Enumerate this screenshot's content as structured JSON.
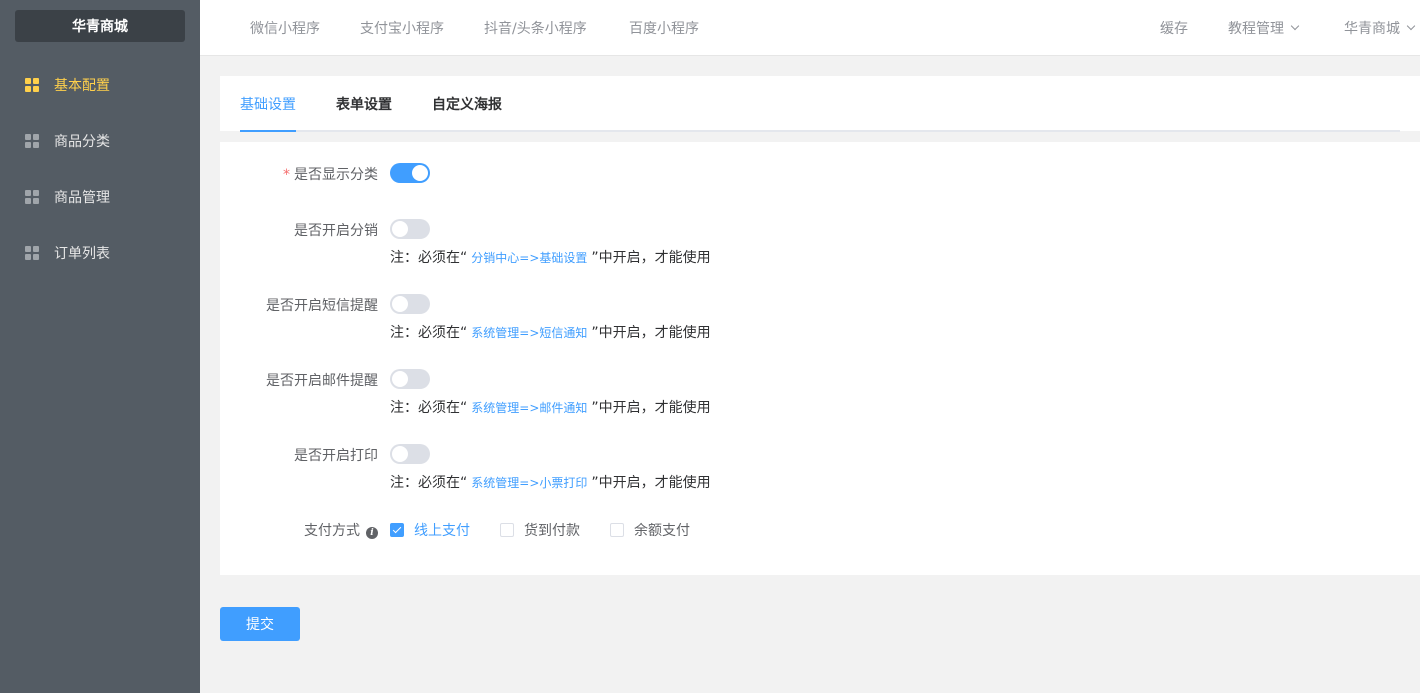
{
  "sidebar": {
    "logo": "华青商城",
    "items": [
      {
        "label": "基本配置",
        "active": true
      },
      {
        "label": "商品分类",
        "active": false
      },
      {
        "label": "商品管理",
        "active": false
      },
      {
        "label": "订单列表",
        "active": false
      }
    ]
  },
  "topnav": {
    "left": [
      "微信小程序",
      "支付宝小程序",
      "抖音/头条小程序",
      "百度小程序"
    ],
    "cache": "缓存",
    "tutorial": "教程管理",
    "shop": "华青商城"
  },
  "tabs": [
    {
      "label": "基础设置",
      "active": true
    },
    {
      "label": "表单设置",
      "active": false
    },
    {
      "label": "自定义海报",
      "active": false
    }
  ],
  "form": {
    "show_category": {
      "required_mark": "*",
      "label": "是否显示分类",
      "enabled": true
    },
    "rows": [
      {
        "label": "是否开启分销",
        "enabled": false,
        "note_prefix": "注：必须在“",
        "note_link": "分销中心=>基础设置",
        "note_suffix": "”中开启，才能使用"
      },
      {
        "label": "是否开启短信提醒",
        "enabled": false,
        "note_prefix": "注：必须在“",
        "note_link": "系统管理=>短信通知",
        "note_suffix": "”中开启，才能使用"
      },
      {
        "label": "是否开启邮件提醒",
        "enabled": false,
        "note_prefix": "注：必须在“",
        "note_link": "系统管理=>邮件通知",
        "note_suffix": "”中开启，才能使用"
      },
      {
        "label": "是否开启打印",
        "enabled": false,
        "note_prefix": "注：必须在“",
        "note_link": "系统管理=>小票打印",
        "note_suffix": "”中开启，才能使用"
      }
    ],
    "payment": {
      "label": "支付方式",
      "info_icon": "info-icon",
      "options": [
        {
          "label": "线上支付",
          "checked": true
        },
        {
          "label": "货到付款",
          "checked": false
        },
        {
          "label": "余额支付",
          "checked": false
        }
      ]
    }
  },
  "submit_label": "提交",
  "colors": {
    "primary": "#409eff",
    "sidebar": "#545c64",
    "active_menu": "#ffd04b"
  }
}
